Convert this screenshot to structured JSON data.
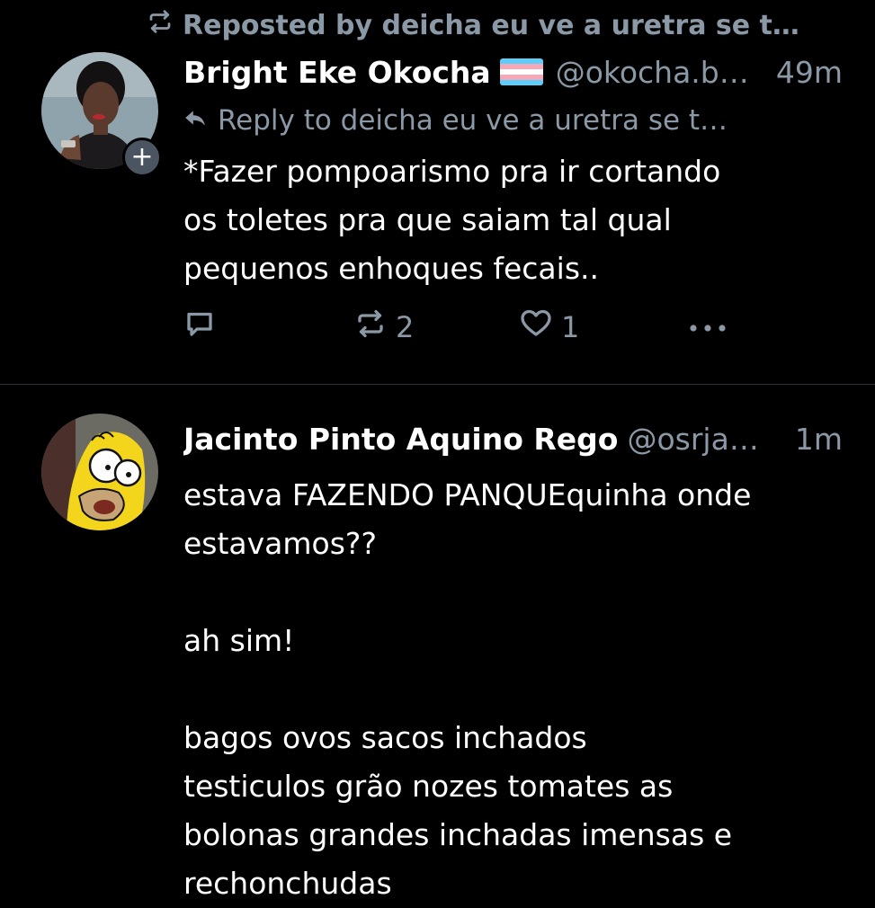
{
  "repost_header": {
    "text": "Reposted by deicha eu ve a uretra se t…",
    "icon": "repost-icon"
  },
  "post1": {
    "display_name": "Bright Eke Okocha",
    "flag": "transgender-flag",
    "handle": "@okocha.b…",
    "timestamp": "49m",
    "reply_to": "Reply to deicha eu ve a uretra se t…",
    "text": "*Fazer pompoarismo pra ir cortando\nos toletes pra que saiam tal qual\npequenos enhoques fecais..",
    "reply_count": "",
    "repost_count": "2",
    "like_count": "1"
  },
  "post2": {
    "display_name": "Jacinto Pinto Aquino Rego",
    "handle": "@osrja…",
    "timestamp": "1m",
    "text": "estava FAZENDO PANQUEquinha onde\nestavamos??\n\nah sim!\n\nbagos ovos sacos inchados\ntesticulos grão nozes tomates as\nbolonas grandes inchadas imensas e\nrechonchudas"
  },
  "colors": {
    "background": "#000000",
    "text": "#ffffff",
    "muted": "#8b98a5",
    "divider": "#2a3138",
    "follow_badge": "#4b5562"
  }
}
